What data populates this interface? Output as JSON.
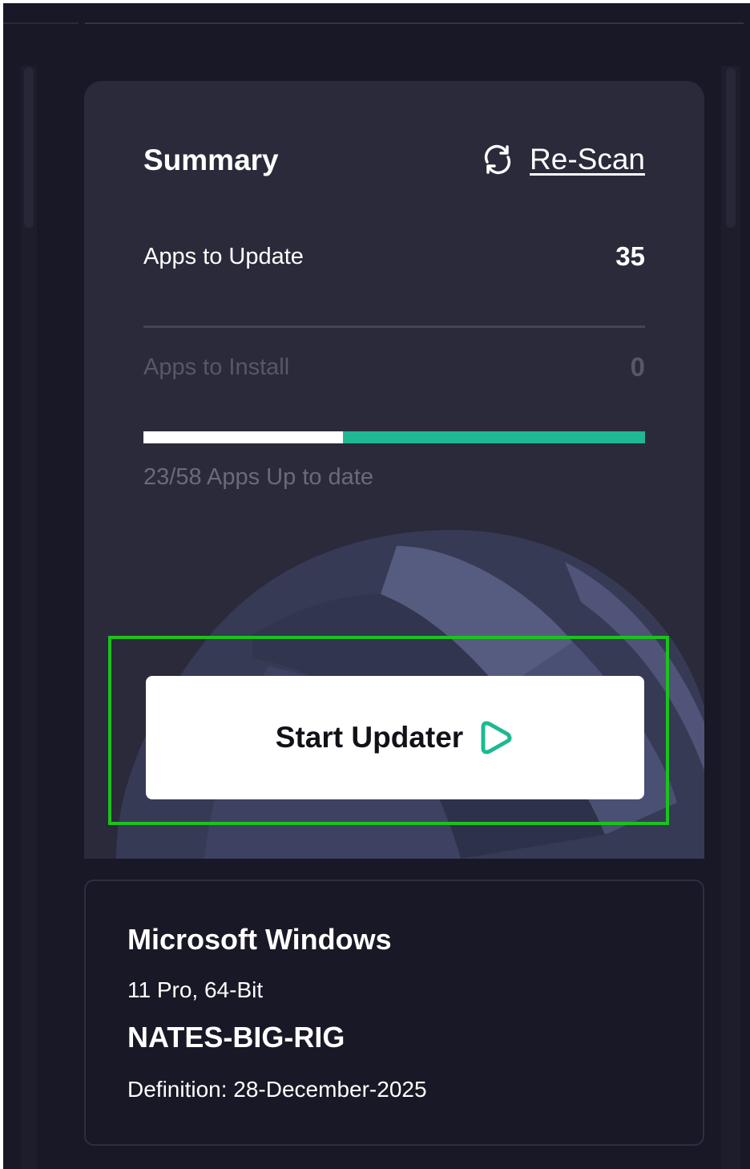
{
  "summary": {
    "title": "Summary",
    "rescan_label": "Re-Scan",
    "apps_to_update_label": "Apps to Update",
    "apps_to_update_value": "35",
    "apps_to_install_label": "Apps to Install",
    "apps_to_install_value": "0",
    "progress_text": "23/58 Apps Up to date",
    "progress_fraction": 0.397,
    "start_button_label": "Start Updater"
  },
  "system": {
    "os_name": "Microsoft Windows",
    "os_version": "11 Pro, 64-Bit",
    "host_name": "NATES-BIG-RIG",
    "definition": "Definition: 28-December-2025"
  },
  "icons": {
    "rescan": "refresh-icon",
    "start": "play-icon"
  },
  "colors": {
    "background": "#181826",
    "card": "#2a2a3b",
    "accent": "#1fb893",
    "highlight": "#1dc21d",
    "muted_text": "#575768"
  }
}
